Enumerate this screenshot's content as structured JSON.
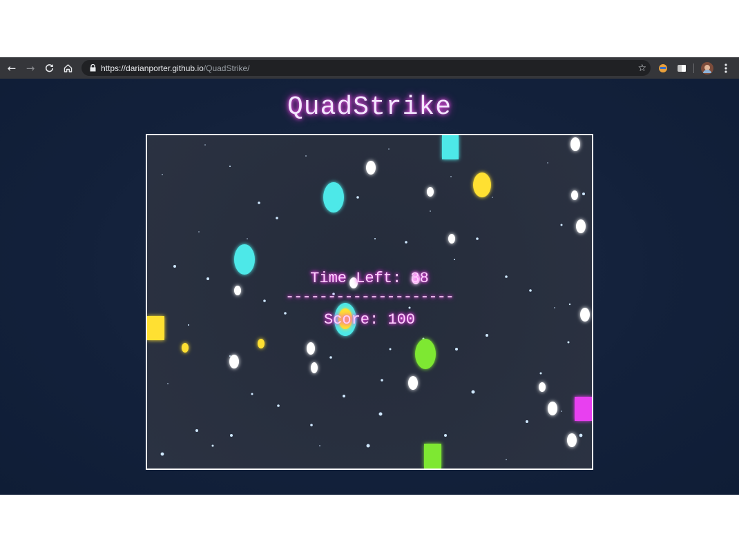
{
  "browser": {
    "url_scheme": "https://",
    "url_host": "darianporter.github.io",
    "url_path": "/QuadStrike/",
    "icons": [
      "back-icon",
      "forward-icon",
      "reload-icon",
      "home-icon",
      "lock-icon",
      "star-icon",
      "extension-icon",
      "extension-icon",
      "profile-avatar",
      "menu-icon"
    ]
  },
  "game": {
    "title": "QuadStrike",
    "time_left_label": "Time Left: 38",
    "separator": "--------------------",
    "score_label": "Score: 100",
    "colors": {
      "cyan": "#4ee8e8",
      "yellow": "#ffe030",
      "green": "#7ee830",
      "magenta": "#e840f0",
      "white": "#ffffff",
      "glow": "#ff4df6"
    }
  }
}
